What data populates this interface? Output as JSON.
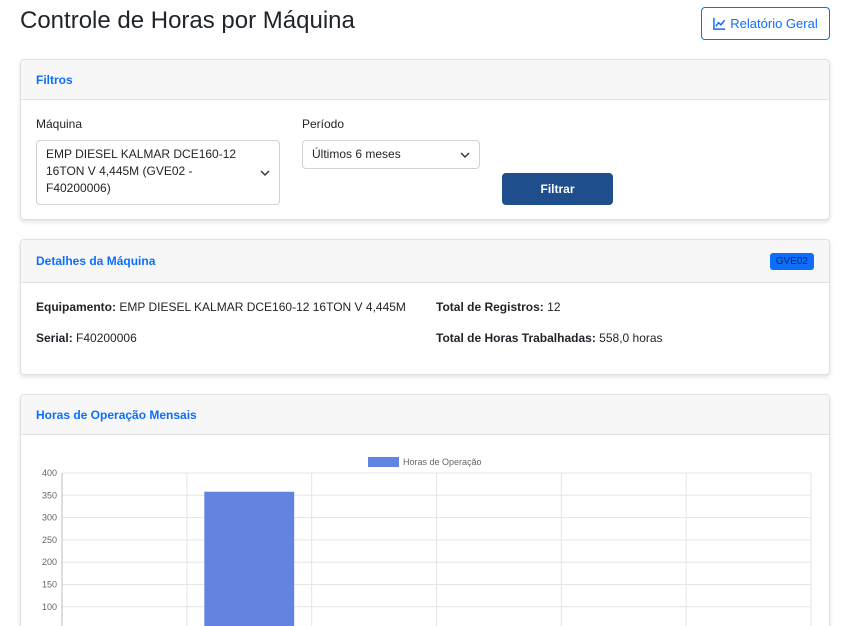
{
  "header": {
    "title": "Controle de Horas por Máquina",
    "report_button_label": "Relatório Geral"
  },
  "filters": {
    "title": "Filtros",
    "machine_label": "Máquina",
    "machine_value": "EMP DIESEL KALMAR DCE160-12 16TON V 4,445M (GVE02 - F40200006)",
    "period_label": "Período",
    "period_value": "Últimos 6 meses",
    "filter_button_label": "Filtrar"
  },
  "details": {
    "title": "Detalhes da Máquina",
    "badge": "GVE02",
    "equipment_label": "Equipamento:",
    "equipment_value": "EMP DIESEL KALMAR DCE160-12 16TON V 4,445M",
    "serial_label": "Serial:",
    "serial_value": "F40200006",
    "total_records_label": "Total de Registros:",
    "total_records_value": "12",
    "total_hours_label": "Total de Horas Trabalhadas:",
    "total_hours_value": "558,0 horas"
  },
  "chart": {
    "title": "Horas de Operação Mensais"
  },
  "colors": {
    "accent": "#0d6efd",
    "filter_button": "#1f4e8c",
    "bar": "#6283e0"
  },
  "icons": {
    "report": "chart-line-icon",
    "select": "chevron-down-icon"
  },
  "chart_data": {
    "type": "bar",
    "categories": [
      "",
      "",
      "",
      "",
      "",
      ""
    ],
    "series": [
      {
        "name": "Horas de Operação",
        "values": [
          0,
          358,
          0,
          0,
          0,
          0
        ]
      }
    ],
    "title": "",
    "xlabel": "",
    "ylabel": "",
    "ylim": [
      0,
      400
    ],
    "yticks": [
      100,
      150,
      200,
      250,
      300,
      350,
      400
    ],
    "grid": true,
    "legend": "top"
  }
}
